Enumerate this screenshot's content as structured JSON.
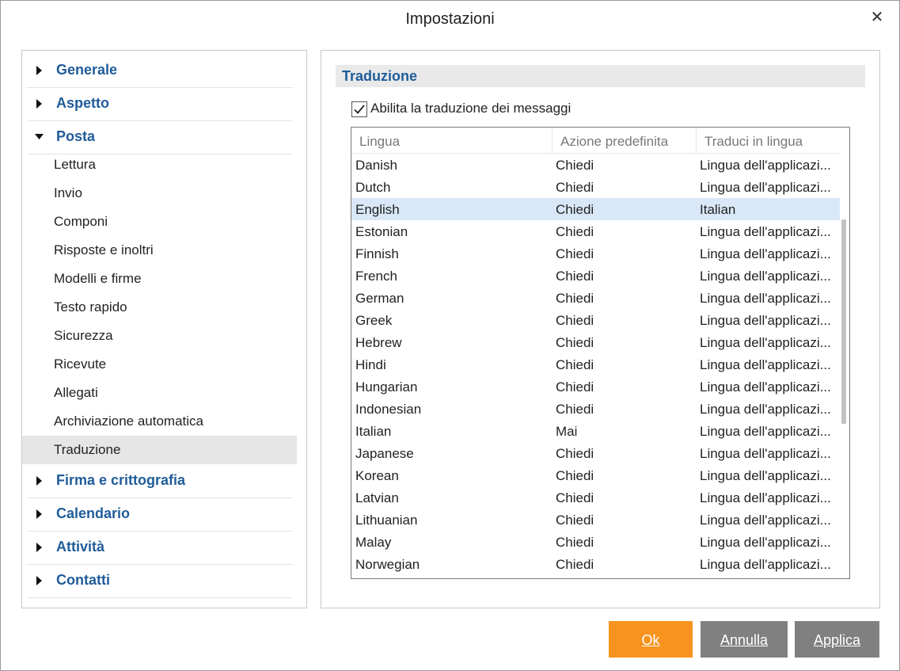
{
  "window": {
    "title": "Impostazioni"
  },
  "nav": {
    "categories_top": [
      {
        "label": "Generale",
        "expanded": false
      },
      {
        "label": "Aspetto",
        "expanded": false
      },
      {
        "label": "Posta",
        "expanded": true
      }
    ],
    "posta_items": [
      "Lettura",
      "Invio",
      "Componi",
      "Risposte e inoltri",
      "Modelli e firme",
      "Testo rapido",
      "Sicurezza",
      "Ricevute",
      "Allegati",
      "Archiviazione automatica",
      "Traduzione"
    ],
    "selected_item": "Traduzione",
    "categories_bottom": [
      {
        "label": "Firma e crittografia",
        "expanded": false
      },
      {
        "label": "Calendario",
        "expanded": false
      },
      {
        "label": "Attività",
        "expanded": false
      },
      {
        "label": "Contatti",
        "expanded": false
      }
    ]
  },
  "panel": {
    "section_title": "Traduzione",
    "enable_checkbox": {
      "label": "Abilita la traduzione dei messaggi",
      "checked": true
    },
    "table": {
      "headers": [
        "Lingua",
        "Azione predefinita",
        "Traduci in lingua"
      ],
      "selected_row": "English",
      "rows": [
        [
          "Danish",
          "Chiedi",
          "Lingua dell'applicazi..."
        ],
        [
          "Dutch",
          "Chiedi",
          "Lingua dell'applicazi..."
        ],
        [
          "English",
          "Chiedi",
          "Italian"
        ],
        [
          "Estonian",
          "Chiedi",
          "Lingua dell'applicazi..."
        ],
        [
          "Finnish",
          "Chiedi",
          "Lingua dell'applicazi..."
        ],
        [
          "French",
          "Chiedi",
          "Lingua dell'applicazi..."
        ],
        [
          "German",
          "Chiedi",
          "Lingua dell'applicazi..."
        ],
        [
          "Greek",
          "Chiedi",
          "Lingua dell'applicazi..."
        ],
        [
          "Hebrew",
          "Chiedi",
          "Lingua dell'applicazi..."
        ],
        [
          "Hindi",
          "Chiedi",
          "Lingua dell'applicazi..."
        ],
        [
          "Hungarian",
          "Chiedi",
          "Lingua dell'applicazi..."
        ],
        [
          "Indonesian",
          "Chiedi",
          "Lingua dell'applicazi..."
        ],
        [
          "Italian",
          "Mai",
          "Lingua dell'applicazi..."
        ],
        [
          "Japanese",
          "Chiedi",
          "Lingua dell'applicazi..."
        ],
        [
          "Korean",
          "Chiedi",
          "Lingua dell'applicazi..."
        ],
        [
          "Latvian",
          "Chiedi",
          "Lingua dell'applicazi..."
        ],
        [
          "Lithuanian",
          "Chiedi",
          "Lingua dell'applicazi..."
        ],
        [
          "Malay",
          "Chiedi",
          "Lingua dell'applicazi..."
        ],
        [
          "Norwegian",
          "Chiedi",
          "Lingua dell'applicazi..."
        ]
      ]
    }
  },
  "buttons": {
    "ok": "Ok",
    "cancel": "Annulla",
    "apply": "Applica"
  },
  "colors": {
    "accent_blue": "#1f5c9a",
    "ok_orange": "#f7931e",
    "button_gray": "#808080",
    "selection_blue": "#d9e8f8",
    "nav_selected": "#e6e6e6"
  },
  "icons": {
    "close": "close-icon",
    "collapsed": "triangle-right-icon",
    "expanded": "triangle-down-icon",
    "check": "checkmark-icon"
  }
}
